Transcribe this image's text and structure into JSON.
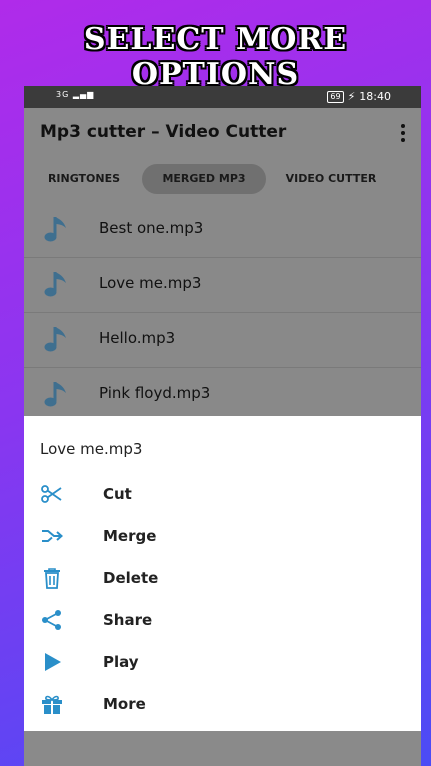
{
  "banner": {
    "text": "SELECT MORE OPTIONS"
  },
  "status_bar": {
    "signal": "3G",
    "battery": "69",
    "time": "18:40"
  },
  "app_bar": {
    "title": "Mp3 cutter – Video Cutter"
  },
  "tabs": [
    {
      "label": "RINGTONES",
      "active": false
    },
    {
      "label": "MERGED MP3",
      "active": true
    },
    {
      "label": "VIDEO CUTTER",
      "active": false
    }
  ],
  "files": [
    {
      "name": "Best one.mp3",
      "icon": "music-note-icon"
    },
    {
      "name": "Love me.mp3",
      "icon": "music-note-icon"
    },
    {
      "name": "Hello.mp3",
      "icon": "music-note-icon"
    },
    {
      "name": "Pink floyd.mp3",
      "icon": "music-note-icon"
    }
  ],
  "sheet": {
    "title": "Love me.mp3",
    "options": [
      {
        "label": "Cut",
        "icon": "scissors-icon"
      },
      {
        "label": "Merge",
        "icon": "merge-icon"
      },
      {
        "label": "Delete",
        "icon": "trash-icon"
      },
      {
        "label": "Share",
        "icon": "share-icon"
      },
      {
        "label": "Play",
        "icon": "play-icon"
      },
      {
        "label": "More",
        "icon": "gift-icon"
      }
    ]
  },
  "colors": {
    "accent": "#2a8fc9",
    "overlay": "#898989",
    "note": "#3f6f8f"
  }
}
